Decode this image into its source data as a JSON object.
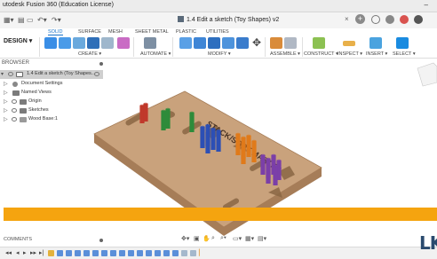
{
  "app": {
    "title": "utodesk Fusion 360 (Education License)",
    "document_tab": "1.4 Edit a sketch (Toy Shapes) v2",
    "minimize": "–"
  },
  "ribbon": {
    "workspace": "DESIGN ▾",
    "tabs": [
      "SOLID",
      "SURFACE",
      "MESH",
      "SHEET METAL",
      "PLASTIC",
      "UTILITIES"
    ],
    "active_tab": "SOLID",
    "groups": [
      "CREATE ▾",
      "AUTOMATE ▾",
      "MODIFY ▾",
      "ASSEMBLE ▾",
      "CONSTRUCT ▾",
      "INSPECT ▾",
      "INSERT ▾",
      "SELECT ▾"
    ]
  },
  "browser": {
    "header": "BROWSER",
    "root": "1.4 Edit a sketch (Toy Shapes...",
    "items": [
      "Document Settings",
      "Named Views",
      "Origin",
      "Sketches",
      "Wood Base:1"
    ]
  },
  "model": {
    "engraving": "STACK/SORT MASTER",
    "colors": {
      "wood": "#c9a27c",
      "wood_edge": "#a67d58",
      "red": "#c0392b",
      "green": "#2e8b3a",
      "blue": "#2c4fb5",
      "orange": "#e07a1a",
      "purple": "#7b3fa8"
    }
  },
  "overlay": {
    "color": "#f5a40f"
  },
  "comments": {
    "label": "COMMENTS"
  },
  "logo": {
    "text": "LK"
  }
}
